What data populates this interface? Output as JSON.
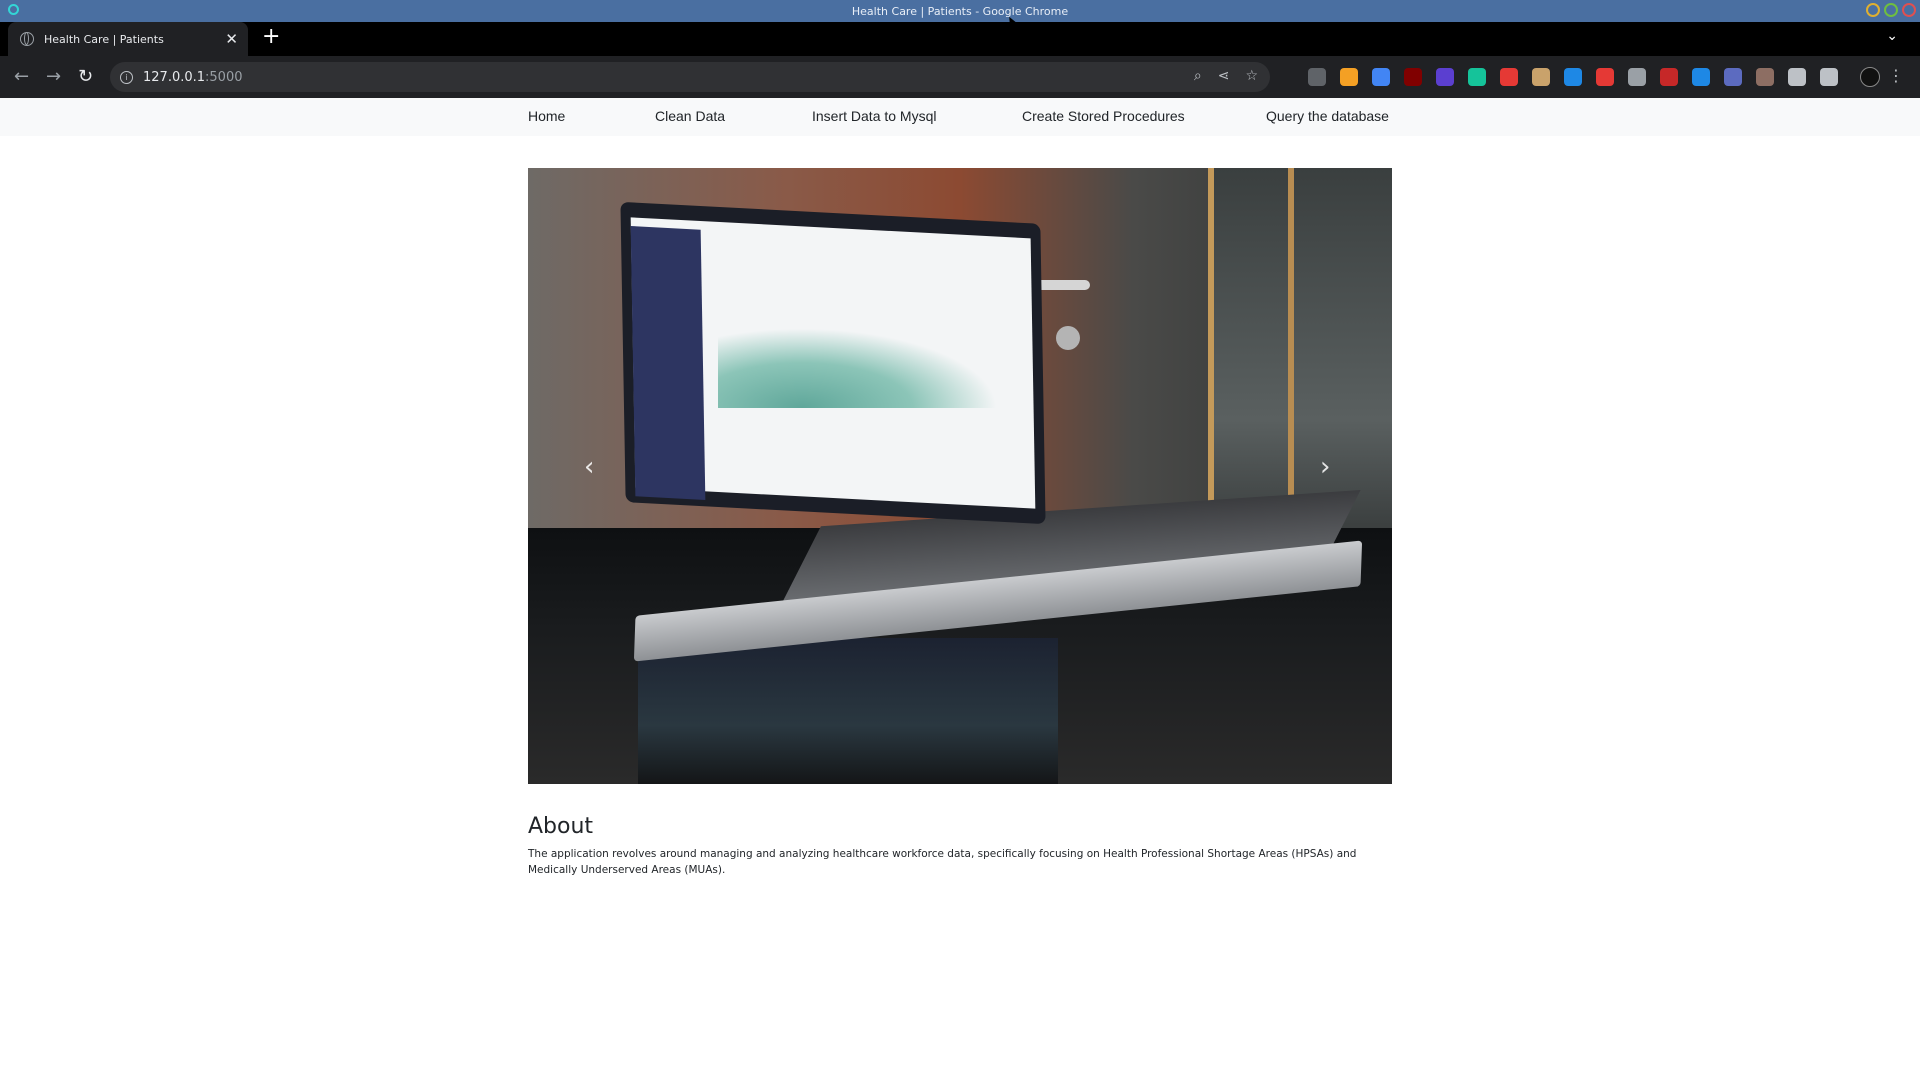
{
  "window": {
    "title": "Health Care | Patients - Google Chrome"
  },
  "browser": {
    "tab": {
      "title": "Health Care | Patients",
      "close": "✕"
    },
    "new_tab": "+",
    "tab_list": "⌄",
    "url_host": "127.0.0.1",
    "url_port": ":5000",
    "nav": {
      "back": "←",
      "forward": "→",
      "reload": "↻"
    },
    "omnibox_icons": [
      "zoom-icon",
      "share-icon",
      "star-icon"
    ],
    "extensions": [
      {
        "name": "shield-extension-icon",
        "color": "#5f6368"
      },
      {
        "name": "extension-icon-2",
        "color": "#f4a024"
      },
      {
        "name": "translate-extension-icon",
        "color": "#4285f4"
      },
      {
        "name": "ublock-extension-icon",
        "color": "#800000"
      },
      {
        "name": "extension-icon-5",
        "color": "#5b3fd0"
      },
      {
        "name": "grammarly-extension-icon",
        "color": "#15c39a"
      },
      {
        "name": "extension-icon-7",
        "color": "#e53935"
      },
      {
        "name": "extension-icon-8",
        "color": "#c9a26b"
      },
      {
        "name": "extension-icon-9",
        "color": "#1e88e5"
      },
      {
        "name": "extension-icon-10",
        "color": "#e53935"
      },
      {
        "name": "globe-extension-icon",
        "color": "#9aa0a6"
      },
      {
        "name": "extension-icon-12",
        "color": "#c62828"
      },
      {
        "name": "extension-icon-13",
        "color": "#1e88e5"
      },
      {
        "name": "extension-icon-14",
        "color": "#5c6bc0"
      },
      {
        "name": "extension-icon-15",
        "color": "#8d6e63"
      },
      {
        "name": "puzzle-icon",
        "color": "#bdc1c6"
      },
      {
        "name": "side-panel-icon",
        "color": "#bdc1c6"
      }
    ],
    "menu": "⋮"
  },
  "navbar": {
    "items": [
      {
        "label": "Home"
      },
      {
        "label": "Clean Data"
      },
      {
        "label": "Insert Data to Mysql"
      },
      {
        "label": "Create Stored Procedures"
      },
      {
        "label": "Query the database"
      }
    ]
  },
  "carousel": {
    "prev": "‹",
    "next": "›"
  },
  "about": {
    "title": "About",
    "text": "The application revolves around managing and analyzing healthcare workforce data, specifically focusing on Health Professional Shortage Areas (HPSAs) and Medically Underserved Areas (MUAs)."
  }
}
